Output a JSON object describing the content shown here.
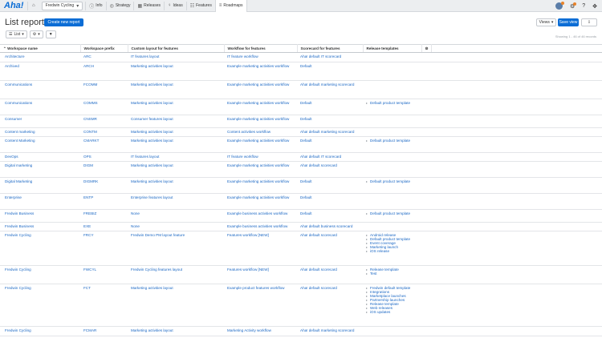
{
  "nav": {
    "logo": "Aha!",
    "workspace": "Fredwin Cycling",
    "items": [
      {
        "label": "Info",
        "icon": "info-icon"
      },
      {
        "label": "Strategy",
        "icon": "strategy-icon"
      },
      {
        "label": "Releases",
        "icon": "calendar-icon"
      },
      {
        "label": "Ideas",
        "icon": "lightbulb-icon"
      },
      {
        "label": "Features",
        "icon": "features-icon"
      },
      {
        "label": "Roadmaps",
        "icon": "roadmaps-icon"
      }
    ]
  },
  "header": {
    "title": "List report",
    "create_label": "Create new report",
    "views_label": "Views",
    "save_label": "Save view"
  },
  "toolbar": {
    "list_label": "List",
    "showing": "Showing 1 - 46 of 46 records"
  },
  "table": {
    "columns": [
      "Workspace name",
      "Workspace prefix",
      "Custom layout for features",
      "Workflow for features",
      "Scorecard for features",
      "Release templates"
    ],
    "rows": [
      {
        "name": "Architecture",
        "prefix": "ARC",
        "layout": "IT features layout",
        "workflow": "IT feature workflow",
        "scorecard": "Aha! default IT scorecard",
        "templates": []
      },
      {
        "name": "Archived",
        "prefix": "ARCH",
        "layout": "Marketing activities layout",
        "workflow": "Example marketing activities workflow",
        "scorecard": "Default",
        "templates": []
      },
      {
        "name": "Communications",
        "prefix": "FCOMM",
        "layout": "Marketing activities layout",
        "workflow": "Example marketing activities workflow",
        "scorecard": "Aha! default marketing scorecard",
        "templates": []
      },
      {
        "name": "Communications",
        "prefix": "COMMS",
        "layout": "Marketing activities layout",
        "workflow": "Example marketing activities workflow",
        "scorecard": "Default",
        "templates": [
          "Default product template"
        ]
      },
      {
        "name": "Consumer",
        "prefix": "CNSMR",
        "layout": "Consumer features layout",
        "workflow": "Example marketing activities workflow",
        "scorecard": "Default",
        "templates": []
      },
      {
        "name": "Content marketing",
        "prefix": "CONTM",
        "layout": "Marketing activities layout",
        "workflow": "Content activities workflow",
        "scorecard": "Aha! default marketing scorecard",
        "templates": []
      },
      {
        "name": "Content Marketing",
        "prefix": "CMARKT",
        "layout": "Marketing activities layout",
        "workflow": "Example marketing activities workflow",
        "scorecard": "Default",
        "templates": [
          "Default product template"
        ]
      },
      {
        "name": "DevOps",
        "prefix": "OPS",
        "layout": "IT features layout",
        "workflow": "IT feature workflow",
        "scorecard": "Aha! default IT scorecard",
        "templates": []
      },
      {
        "name": "Digital marketing",
        "prefix": "DIGM",
        "layout": "Marketing activities layout",
        "workflow": "Example marketing activities workflow",
        "scorecard": "Aha! default scorecard",
        "templates": []
      },
      {
        "name": "Digital Marketing",
        "prefix": "DIGMRK",
        "layout": "Marketing activities layout",
        "workflow": "Example marketing activities workflow",
        "scorecard": "Default",
        "templates": [
          "Default product template"
        ]
      },
      {
        "name": "Enterprise",
        "prefix": "ENTP",
        "layout": "Enterprise features layout",
        "workflow": "Example marketing activities workflow",
        "scorecard": "Default",
        "templates": []
      },
      {
        "name": "Fredwin Business",
        "prefix": "FREBIZ",
        "layout": "None",
        "workflow": "Example business activities workflow",
        "scorecard": "Default",
        "templates": [
          "Default product template"
        ]
      },
      {
        "name": "Fredwin Business",
        "prefix": "EXE",
        "layout": "None",
        "workflow": "Example business activities workflow",
        "scorecard": "Aha! default business scorecard",
        "templates": []
      },
      {
        "name": "Fredwin Cycling",
        "prefix": "FRCY",
        "layout": "Fredwin Demo PM layout feature",
        "workflow": "Features workflow [NEW]",
        "scorecard": "Aha! default scorecard",
        "templates": [
          "Android release",
          "Default product template",
          "Event coverage",
          "Marketing launch",
          "iOS release"
        ]
      },
      {
        "name": "Fredwin Cycling",
        "prefix": "FWCYL",
        "layout": "Fredwin Cycling features layout",
        "workflow": "Features workflow [NEW]",
        "scorecard": "Aha! default scorecard",
        "templates": [
          "Release template",
          "Test"
        ]
      },
      {
        "name": "Fredwin Cycling",
        "prefix": "FCT",
        "layout": "Marketing activities layout",
        "workflow": "Example product features workflow",
        "scorecard": "Aha! default scorecard",
        "templates": [
          "Fredwin default template",
          "Integrations",
          "Marketplace launches",
          "Partnership launches",
          "Release template",
          "Web releases",
          "iOS updates"
        ]
      },
      {
        "name": "Fredwin Cycling",
        "prefix": "FCMAR",
        "layout": "Marketing activities layout",
        "workflow": "Marketing Activity workflow",
        "scorecard": "Aha! default marketing scorecard",
        "templates": []
      }
    ]
  },
  "colors": {
    "accent": "#0b6dd5",
    "link": "#1a67c4"
  }
}
